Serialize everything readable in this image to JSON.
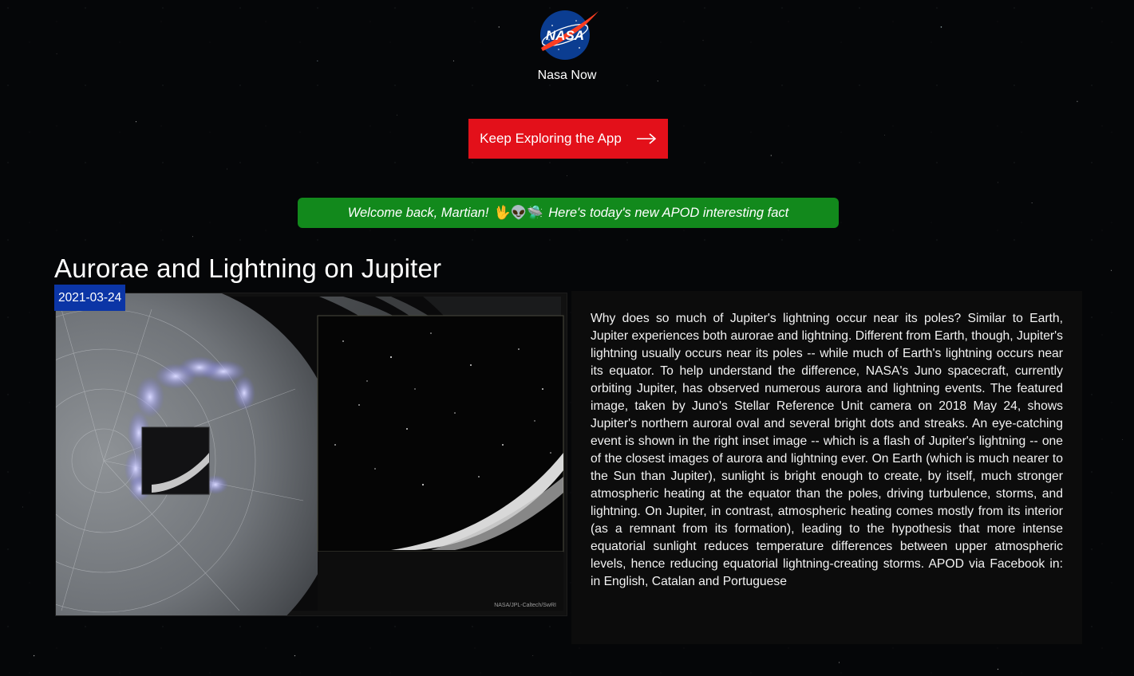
{
  "header": {
    "logo_text": "NASA",
    "brand_name": "Nasa Now"
  },
  "cta": {
    "label": "Keep Exploring the App"
  },
  "welcome": {
    "text_before": "Welcome back, Martian!",
    "emojis": "🖖👽🛸",
    "text_after": "Here's today's new APOD interesting fact"
  },
  "apod": {
    "title": "Aurorae and Lightning on Jupiter",
    "date": "2021-03-24",
    "image_credit": "NASA/JPL-Caltech/SwRI",
    "description": "Why does so much of Jupiter's lightning occur near its poles? Similar to Earth, Jupiter experiences both aurorae and lightning. Different from Earth, though, Jupiter's lightning usually occurs near its poles -- while much of Earth's lightning occurs near its equator. To help understand the difference, NASA's Juno spacecraft, currently orbiting Jupiter, has observed numerous aurora and lightning events. The featured image, taken by Juno's Stellar Reference Unit camera on 2018 May 24, shows Jupiter's northern auroral oval and several bright dots and streaks. An eye-catching event is shown in the right inset image -- which is a flash of Jupiter's lightning -- one of the closest images of aurora and lightning ever. On Earth (which is much nearer to the Sun than Jupiter), sunlight is bright enough to create, by itself, much stronger atmospheric heating at the equator than the poles, driving turbulence, storms, and lightning. On Jupiter, in contrast, atmospheric heating comes mostly from its interior (as a remnant from its formation), leading to the hypothesis that more intense equatorial sunlight reduces temperature differences between upper atmospheric levels, hence reducing equatorial lightning-creating storms. APOD via Facebook in: in English, Catalan and Portuguese"
  },
  "colors": {
    "cta_red": "#e3101a",
    "welcome_green": "#12891c",
    "date_blue": "#0b35a6",
    "nasa_blue": "#0b3d91"
  },
  "icons": {
    "logo": "nasa-meatball-icon",
    "cta": "arrow-right-icon"
  }
}
